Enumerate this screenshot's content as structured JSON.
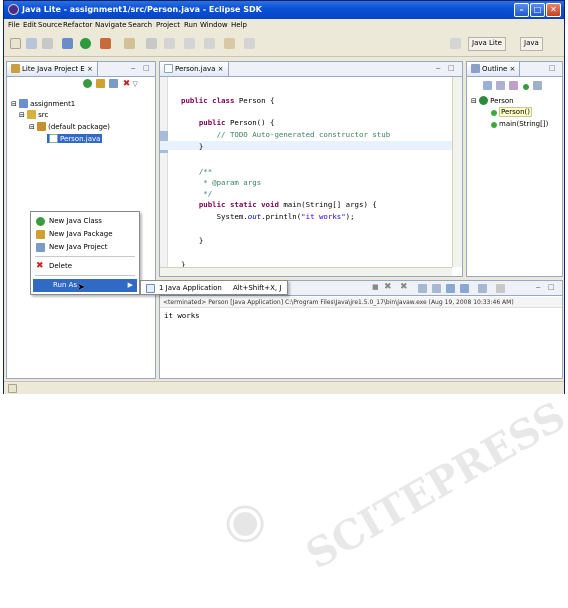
{
  "window": {
    "title": "Java Lite - assignment1/src/Person.java - Eclipse SDK"
  },
  "menubar": [
    "File",
    "Edit",
    "Source",
    "Refactor",
    "Navigate",
    "Search",
    "Project",
    "Run",
    "Window",
    "Help"
  ],
  "perspectives": {
    "java_lite": "Java Lite",
    "java": "Java"
  },
  "project_explorer": {
    "tab_label": "Lite Java Project E",
    "tree": [
      "assignment1",
      "src",
      "(default package)",
      "Person.java"
    ]
  },
  "editor": {
    "tab_label": "Person.java",
    "code": {
      "l1_kw": "public class",
      "l1_rest": " Person {",
      "l2_kw": "public",
      "l2_rest": " Person() {",
      "l3_comment": "// TODO Auto-generated constructor stub",
      "l4": "}",
      "l5": "/**",
      "l6": " * @param args",
      "l7": " */",
      "l8_kw": "public static void",
      "l8_rest": " main(String[] args) {",
      "l9_pre": "System.",
      "l9_field": "out",
      "l9_mid": ".println(",
      "l9_str": "\"it works\"",
      "l9_end": ");",
      "l10": "}",
      "l11": "}"
    }
  },
  "outline": {
    "tab_label": "Outline",
    "items": [
      "Person",
      "Person()",
      "main(String[])"
    ]
  },
  "console": {
    "terminated_line": "<terminated> Person [Java Application] C:\\Program Files\\Java\\jre1.5.0_17\\bin\\javaw.exe (Aug 19, 2008 10:33:46 AM)",
    "output": "it works"
  },
  "context_menu": {
    "items": [
      "New Java Class",
      "New Java Package",
      "New Java Project",
      "Delete",
      "Run As"
    ],
    "submenu": {
      "item": "1 Java Application",
      "shortcut": "Alt+Shift+X, J"
    }
  },
  "watermark": "SCITEPRESS Science and Technology Publications",
  "colors": {
    "keyword": "#7f0055",
    "comment": "#3f7f5f",
    "string": "#2a00ff",
    "titlebar": "#0a52d6"
  }
}
